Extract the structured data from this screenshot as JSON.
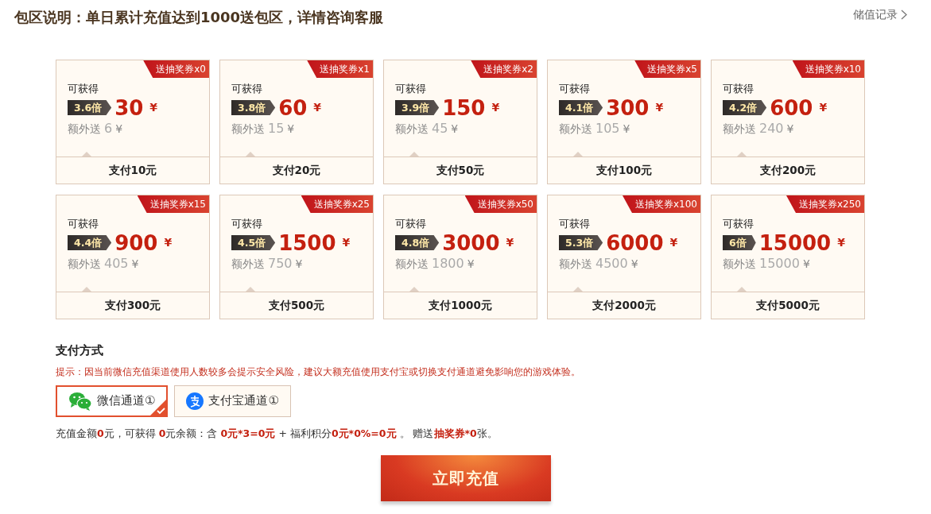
{
  "header": {
    "title": "包区说明：单日累计充值达到1000送包区，详情咨询客服",
    "record_link": "储值记录"
  },
  "packages": [
    {
      "ribbon": "送抽奖券x0",
      "label": "可获得",
      "multiplier": "3.6倍",
      "amount": "30",
      "currency": "¥",
      "bonus_label": "额外送",
      "bonus": "6",
      "bonus_currency": "¥",
      "pay": "支付10元"
    },
    {
      "ribbon": "送抽奖券x1",
      "label": "可获得",
      "multiplier": "3.8倍",
      "amount": "60",
      "currency": "¥",
      "bonus_label": "额外送",
      "bonus": "15",
      "bonus_currency": "¥",
      "pay": "支付20元"
    },
    {
      "ribbon": "送抽奖券x2",
      "label": "可获得",
      "multiplier": "3.9倍",
      "amount": "150",
      "currency": "¥",
      "bonus_label": "额外送",
      "bonus": "45",
      "bonus_currency": "¥",
      "pay": "支付50元"
    },
    {
      "ribbon": "送抽奖券x5",
      "label": "可获得",
      "multiplier": "4.1倍",
      "amount": "300",
      "currency": "¥",
      "bonus_label": "额外送",
      "bonus": "105",
      "bonus_currency": "¥",
      "pay": "支付100元"
    },
    {
      "ribbon": "送抽奖券x10",
      "label": "可获得",
      "multiplier": "4.2倍",
      "amount": "600",
      "currency": "¥",
      "bonus_label": "额外送",
      "bonus": "240",
      "bonus_currency": "¥",
      "pay": "支付200元"
    },
    {
      "ribbon": "送抽奖券x15",
      "label": "可获得",
      "multiplier": "4.4倍",
      "amount": "900",
      "currency": "¥",
      "bonus_label": "额外送",
      "bonus": "405",
      "bonus_currency": "¥",
      "pay": "支付300元"
    },
    {
      "ribbon": "送抽奖券x25",
      "label": "可获得",
      "multiplier": "4.5倍",
      "amount": "1500",
      "currency": "¥",
      "bonus_label": "额外送",
      "bonus": "750",
      "bonus_currency": "¥",
      "pay": "支付500元"
    },
    {
      "ribbon": "送抽奖券x50",
      "label": "可获得",
      "multiplier": "4.8倍",
      "amount": "3000",
      "currency": "¥",
      "bonus_label": "额外送",
      "bonus": "1800",
      "bonus_currency": "¥",
      "pay": "支付1000元"
    },
    {
      "ribbon": "送抽奖券x100",
      "label": "可获得",
      "multiplier": "5.3倍",
      "amount": "6000",
      "currency": "¥",
      "bonus_label": "额外送",
      "bonus": "4500",
      "bonus_currency": "¥",
      "pay": "支付2000元"
    },
    {
      "ribbon": "送抽奖券x250",
      "label": "可获得",
      "multiplier": "6倍",
      "amount": "15000",
      "currency": "¥",
      "bonus_label": "额外送",
      "bonus": "15000",
      "bonus_currency": "¥",
      "pay": "支付5000元"
    }
  ],
  "payment": {
    "title": "支付方式",
    "notice": "提示：因当前微信充值渠道使用人数较多会提示安全风险，建议大额充值使用支付宝或切换支付通道避免影响您的游戏体验。",
    "channels": [
      {
        "kind": "wechat",
        "label": "微信通道①",
        "selected": true
      },
      {
        "kind": "alipay",
        "label": "支付宝通道①",
        "selected": false
      }
    ],
    "summary": "充值金额**0**元，可获得 **0**元余额：含 **0元*3=0元** + 福利积分**0元*0%=0元** 。 赠送**抽奖券*0**张。"
  },
  "submit_button": "立即充值"
}
